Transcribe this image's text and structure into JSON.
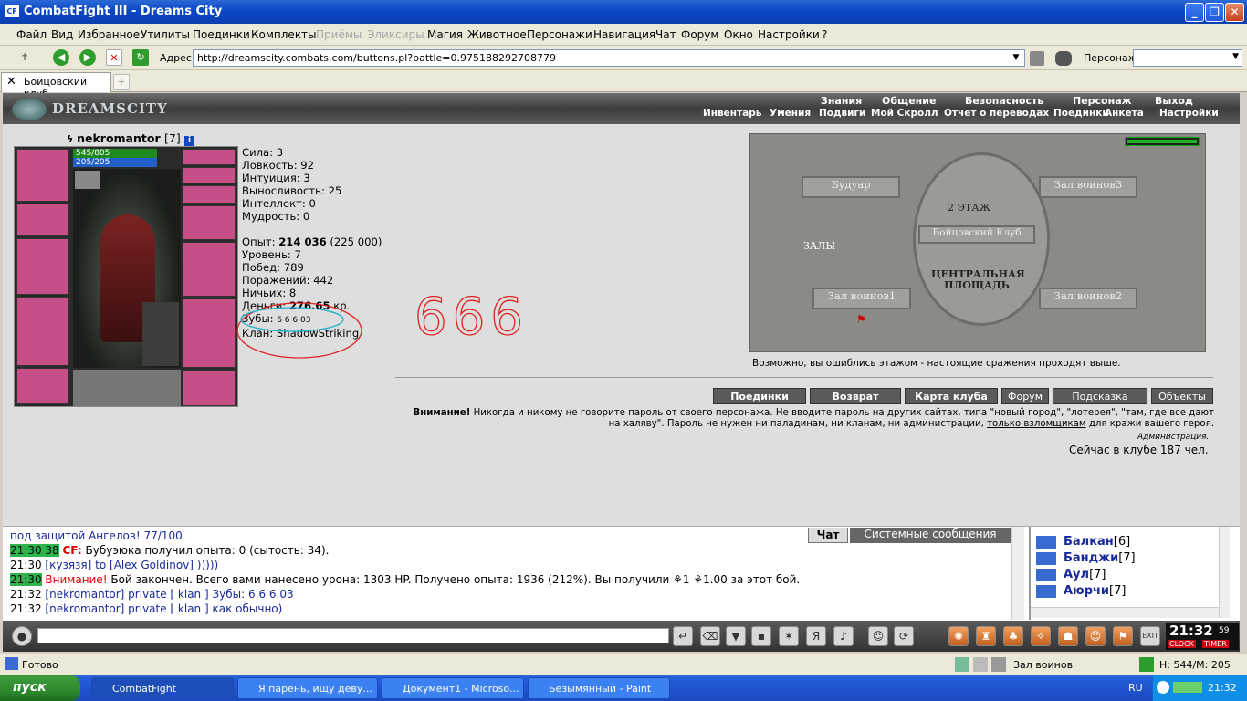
{
  "window": {
    "title": "CombatFight III - Dreams City",
    "app_icon": "CF"
  },
  "menu": [
    "Файл",
    "Вид",
    "Избранное",
    "Утилиты",
    "Поединки",
    "Комплекты",
    "Приёмы",
    "Эликсиры",
    "Магия",
    "Животное",
    "Персонажи",
    "Навигация",
    "Чат",
    "Форум",
    "Окно",
    "Настройки",
    "?"
  ],
  "menu_disabled": [
    "Приёмы",
    "Эликсиры"
  ],
  "address": {
    "label": "Адрес:",
    "url": "http://dreamscity.combats.com/buttons.pl?battle=0.975188292708779",
    "persona_label": "Персонаж:"
  },
  "tab": {
    "label": "Бойцовский клуб"
  },
  "game_nav": {
    "logo": "DREAMSCITY",
    "row1": [
      "Знания",
      "Общение",
      "Безопасность",
      "Персонаж",
      "Выход"
    ],
    "row2": [
      "Инвентарь",
      "Умения",
      "Подвиги",
      "Мой Скролл",
      "Отчет о переводах",
      "Поединки",
      "Анкета",
      "Настройки"
    ]
  },
  "character": {
    "name": "nekromantor",
    "level": "[7]",
    "hp": "545/805",
    "mp": "205/205"
  },
  "stats": {
    "strength": "Сила: 3",
    "agility": "Ловкость: 92",
    "intuition": "Интуиция: 3",
    "endurance": "Выносливость: 25",
    "intellect": "Интеллект: 0",
    "wisdom": "Мудрость: 0",
    "exp_label": "Опыт:",
    "exp_value": "214 036",
    "exp_next": "(225 000)",
    "level": "Уровень: 7",
    "wins": "Побед: 789",
    "losses": "Поражений: 442",
    "draws": "Ничьих: 8",
    "money_label": "Деньги:",
    "money_value": "276.65",
    "money_unit": "кр.",
    "teeth_label": "Зубы:",
    "teeth_value": "6 6 6.03",
    "clan": "Клан: ShadowStriking"
  },
  "handwritten": "666",
  "map": {
    "rooms": [
      "Будуар",
      "Зал воинов3",
      "2 ЭТАЖ",
      "Бойцовский Клуб",
      "ЗАЛЫ",
      "ЦЕНТРАЛЬНАЯ ПЛОЩАДЬ",
      "Зал воинов1",
      "Зал воинов2"
    ],
    "message": "Возможно, вы ошиблись этажом - настоящие сражения проходят выше."
  },
  "buttons": [
    "Поединки",
    "Возврат",
    "Карта клуба",
    "Форум",
    "Подсказка",
    "Объекты"
  ],
  "warning": {
    "bold": "Внимание!",
    "text": "Никогда и никому не говорите пароль от своего персонажа. Не вводите пароль на других сайтах, типа \"новый город\", \"лотерея\", \"там, где все дают на халяву\". Пароль не нужен ни паладинам, ни кланам, ни администрации,",
    "link": "только взломщикам",
    "tail": "для кражи вашего героя.",
    "signature": "Администрация."
  },
  "online": "Сейчас в клубе 187 чел.",
  "chat": {
    "tabs": [
      "Чат",
      "Системные сообщения"
    ],
    "lines": [
      {
        "ts": "",
        "text": "под защитой Ангелов! 77/100"
      },
      {
        "ts": "21:30 38",
        "hl": true,
        "prefix": "CF:",
        "text": "Бубуэюка получил опыта: 0 (сытость: 34)."
      },
      {
        "ts": "21:30",
        "text": "[кузязя] to [Alex Goldinov] )))))"
      },
      {
        "ts": "21:30",
        "hl": true,
        "prefix": "Внимание!",
        "text": "Бой закончен. Всего вами нанесено урона: 1303 HP. Получено опыта: 1936 (212%). Вы получили ⚘1 ⚘1.00 за этот бой."
      },
      {
        "ts": "21:32",
        "text": "[nekromantor] private [ klan ] Зубы: 6 6 6.03"
      },
      {
        "ts": "21:32",
        "text": "[nekromantor] private [ klan ] как обычно)"
      }
    ]
  },
  "users": [
    {
      "name": "Балкан",
      "level": "[6]"
    },
    {
      "name": "Банджи",
      "level": "[7]"
    },
    {
      "name": "Аул",
      "level": "[7]"
    },
    {
      "name": "Аюрчи",
      "level": "[7]"
    }
  ],
  "clock": {
    "time": "21:32",
    "sec": "59",
    "clock_label": "CLOCK",
    "timer_label": "TIMER"
  },
  "status": {
    "left": "Готово",
    "room": "Зал воинов",
    "hpmp": "H: 544/M: 205"
  },
  "taskbar": {
    "start": "пуск",
    "items": [
      "CombatFight",
      "Я парень, ищу деву...",
      "Документ1 - Microso...",
      "Безымянный - Paint"
    ],
    "lang": "RU",
    "time": "21:32"
  }
}
